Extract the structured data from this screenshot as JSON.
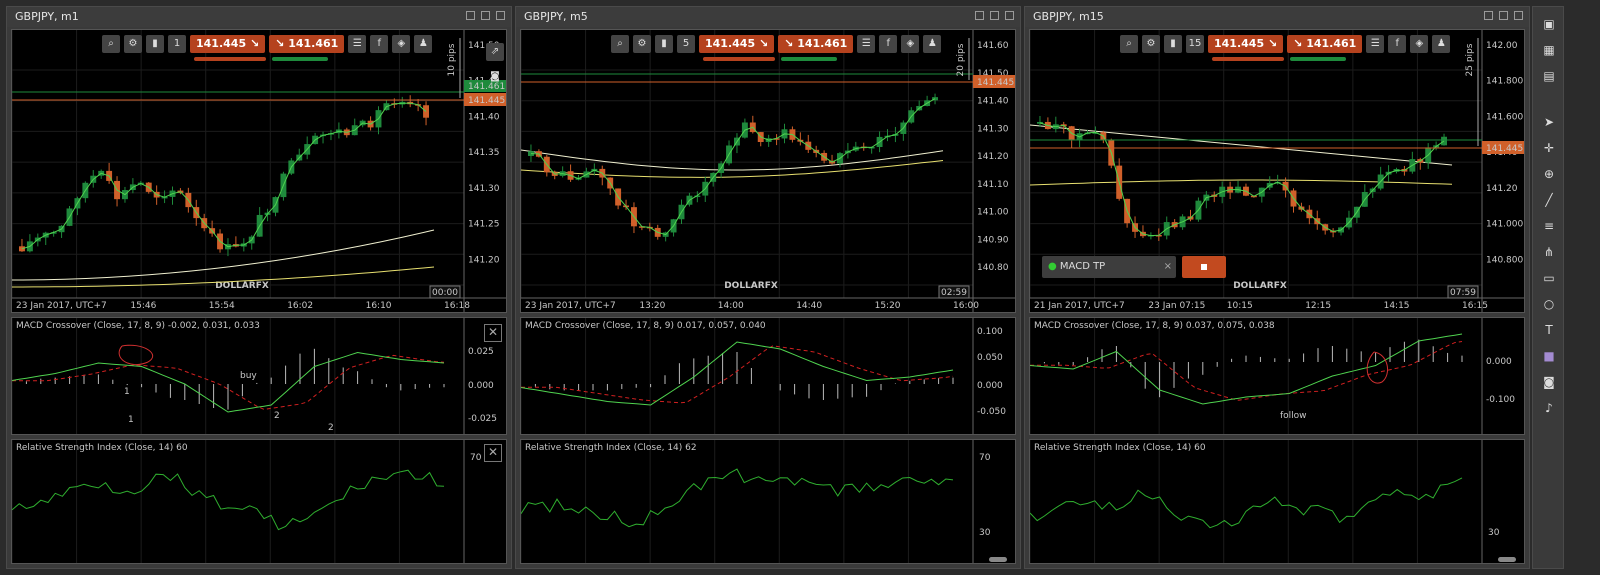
{
  "panels": [
    {
      "title": "GBPJPY, m1",
      "sell_price": "141.445",
      "buy_price": "141.461",
      "timeframe_badge": "1",
      "pips_label": "10 pips",
      "yticks": [
        "141.50",
        "141.45",
        "141.40",
        "141.35",
        "141.30",
        "141.25",
        "141.20"
      ],
      "xticks": [
        "23 Jan 2017, UTC+7",
        "15:46",
        "15:54",
        "16:02",
        "16:10",
        "16:18"
      ],
      "bid_tag": "141.445",
      "ask_tag": "141.461",
      "countdown": "00:00",
      "macd_title": "MACD Crossover (Close, 17, 8, 9) -0.002, 0.031, 0.033",
      "macd_yticks": [
        "0.025",
        "0.000",
        "-0.025"
      ],
      "rsi_title": "Relative Strength Index (Close, 14) 60",
      "rsi_yticks": [
        "70"
      ],
      "annotations": [
        "1",
        "buy",
        "1",
        "2",
        "2"
      ]
    },
    {
      "title": "GBPJPY, m5",
      "sell_price": "141.445",
      "buy_price": "141.461",
      "timeframe_badge": "5",
      "pips_label": "20 pips",
      "yticks": [
        "141.60",
        "141.50",
        "141.40",
        "141.30",
        "141.20",
        "141.10",
        "141.00",
        "140.90",
        "140.80"
      ],
      "xticks": [
        "23 Jan 2017, UTC+7",
        "13:20",
        "14:00",
        "14:40",
        "15:20",
        "16:00"
      ],
      "bid_tag": "141.445",
      "countdown": "02:59",
      "macd_title": "MACD Crossover (Close, 17, 8, 9) 0.017, 0.057, 0.040",
      "macd_yticks": [
        "0.100",
        "0.050",
        "0.000",
        "-0.050"
      ],
      "rsi_title": "Relative Strength Index (Close, 14) 62",
      "rsi_yticks": [
        "70",
        "30"
      ]
    },
    {
      "title": "GBPJPY, m15",
      "sell_price": "141.445",
      "buy_price": "141.461",
      "timeframe_badge": "15",
      "pips_label": "25 pips",
      "yticks": [
        "142.00",
        "141.800",
        "141.600",
        "141.40",
        "141.20",
        "141.000",
        "140.800"
      ],
      "xticks": [
        "21 Jan 2017, UTC+7",
        "23 Jan 07:15",
        "10:15",
        "12:15",
        "14:15",
        "16:15"
      ],
      "bid_tag": "141.445",
      "countdown": "07:59",
      "macd_title": "MACD Crossover (Close, 17, 8, 9) 0.037, 0.075, 0.038",
      "macd_yticks": [
        "0.000",
        "-0.100"
      ],
      "rsi_title": "Relative Strength Index (Close, 14) 60",
      "rsi_yticks": [
        "30"
      ],
      "bot_label": "MACD TP",
      "annotations": [
        "follow"
      ]
    }
  ],
  "watermark": "DOLLARFX",
  "colors": {
    "sell": "#b5421e",
    "buy": "#b5421e",
    "bull": "#1f8a3c",
    "bear": "#d0602a",
    "ma_fast": "#4fd34f",
    "ma_mid": "#f0f0d0",
    "ma_slow": "#e8e070",
    "signal": "#d02020"
  },
  "sidebar_icons": [
    "layout-single-icon",
    "layout-grid-icon",
    "layout-split-icon",
    "cursor-icon",
    "crosshair-icon",
    "zoom-icon",
    "line-icon",
    "fib-icon",
    "pitchfork-icon",
    "rectangle-icon",
    "ellipse-icon",
    "text-icon",
    "color-icon",
    "camera-icon",
    "alert-icon"
  ]
}
